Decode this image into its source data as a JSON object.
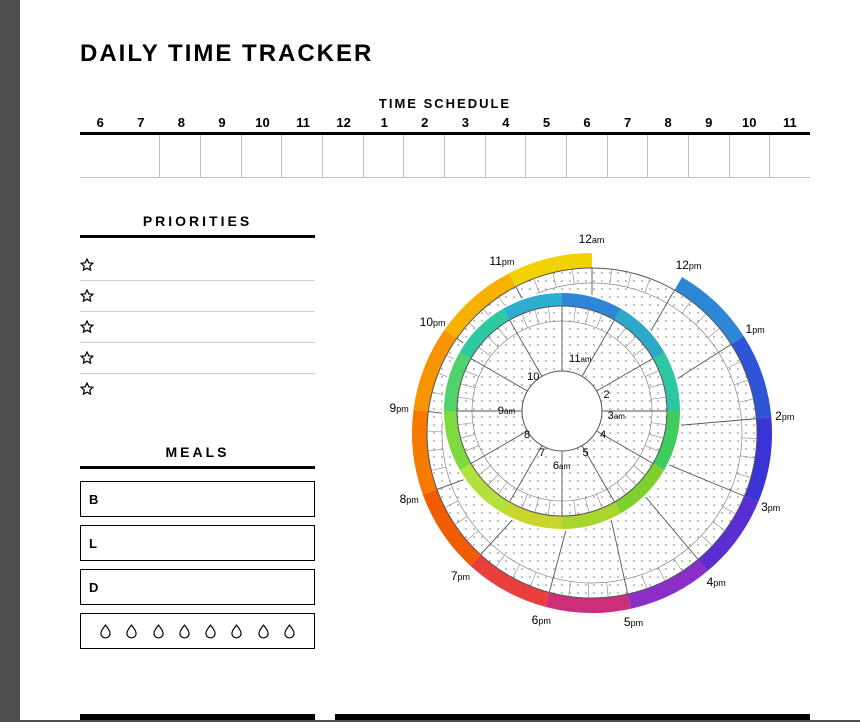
{
  "title": "DAILY TIME TRACKER",
  "schedule": {
    "heading": "TIME SCHEDULE",
    "hours": [
      "6",
      "7",
      "8",
      "9",
      "10",
      "11",
      "12",
      "1",
      "2",
      "3",
      "4",
      "5",
      "6",
      "7",
      "8",
      "9",
      "10",
      "11"
    ]
  },
  "priorities": {
    "heading": "PRIORITIES",
    "items": [
      "",
      "",
      "",
      "",
      ""
    ]
  },
  "meals": {
    "heading": "MEALS",
    "entries": [
      {
        "code": "B",
        "value": ""
      },
      {
        "code": "L",
        "value": ""
      },
      {
        "code": "D",
        "value": ""
      }
    ],
    "water_count": 8
  },
  "clock": {
    "outer": [
      {
        "h": "12",
        "p": "am"
      },
      {
        "h": "12",
        "p": "pm"
      },
      {
        "h": "1",
        "p": "pm"
      },
      {
        "h": "2",
        "p": "pm"
      },
      {
        "h": "3",
        "p": "pm"
      },
      {
        "h": "4",
        "p": "pm"
      },
      {
        "h": "5",
        "p": "pm"
      },
      {
        "h": "6",
        "p": "pm"
      },
      {
        "h": "7",
        "p": "pm"
      },
      {
        "h": "8",
        "p": "pm"
      },
      {
        "h": "9",
        "p": "pm"
      },
      {
        "h": "10",
        "p": "pm"
      },
      {
        "h": "11",
        "p": "pm"
      }
    ],
    "inner": [
      {
        "h": "11",
        "p": "am"
      },
      {
        "h": "2",
        "p": ""
      },
      {
        "h": "3",
        "p": "am"
      },
      {
        "h": "4",
        "p": ""
      },
      {
        "h": "5",
        "p": ""
      },
      {
        "h": "6",
        "p": "am"
      },
      {
        "h": "7",
        "p": ""
      },
      {
        "h": "8",
        "p": ""
      },
      {
        "h": "9",
        "p": "am"
      },
      {
        "h": "10",
        "p": ""
      }
    ]
  }
}
